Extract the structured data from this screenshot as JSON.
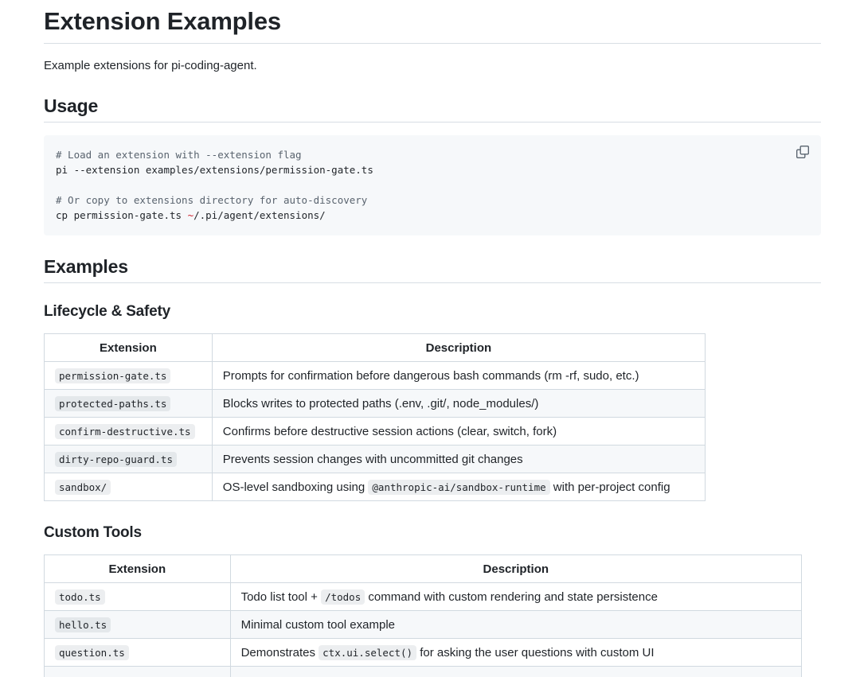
{
  "page_title": "Extension Examples",
  "intro": "Example extensions for pi-coding-agent.",
  "usage": {
    "heading": "Usage",
    "code_lines": [
      {
        "text": "# Load an extension with --extension flag",
        "kind": "comment"
      },
      {
        "text": "pi --extension examples/extensions/permission-gate.ts",
        "kind": "code"
      },
      {
        "text": "",
        "kind": "blank"
      },
      {
        "text": "# Or copy to extensions directory for auto-discovery",
        "kind": "comment"
      },
      {
        "text_before": "cp permission-gate.ts ",
        "text_tilde": "~",
        "text_after": "/.pi/agent/extensions/",
        "kind": "code-tilde"
      }
    ],
    "copy_icon": "copy-icon"
  },
  "examples": {
    "heading": "Examples",
    "lifecycle": {
      "heading": "Lifecycle & Safety",
      "columns": [
        "Extension",
        "Description"
      ],
      "rows": [
        {
          "extension": "permission-gate.ts",
          "description": "Prompts for confirmation before dangerous bash commands (rm -rf, sudo, etc.)"
        },
        {
          "extension": "protected-paths.ts",
          "description": "Blocks writes to protected paths (.env, .git/, node_modules/)"
        },
        {
          "extension": "confirm-destructive.ts",
          "description": "Confirms before destructive session actions (clear, switch, fork)"
        },
        {
          "extension": "dirty-repo-guard.ts",
          "description": "Prevents session changes with uncommitted git changes"
        },
        {
          "extension": "sandbox/",
          "description_before": "OS-level sandboxing using ",
          "description_code": "@anthropic-ai/sandbox-runtime",
          "description_after": " with per-project config"
        }
      ]
    },
    "custom_tools": {
      "heading": "Custom Tools",
      "columns": [
        "Extension",
        "Description"
      ],
      "rows": [
        {
          "extension": "todo.ts",
          "description_before": "Todo list tool + ",
          "description_code": "/todos",
          "description_after": " command with custom rendering and state persistence"
        },
        {
          "extension": "hello.ts",
          "description": "Minimal custom tool example"
        },
        {
          "extension": "question.ts",
          "description_before": "Demonstrates ",
          "description_code": "ctx.ui.select()",
          "description_after": " for asking the user questions with custom UI"
        }
      ]
    }
  }
}
